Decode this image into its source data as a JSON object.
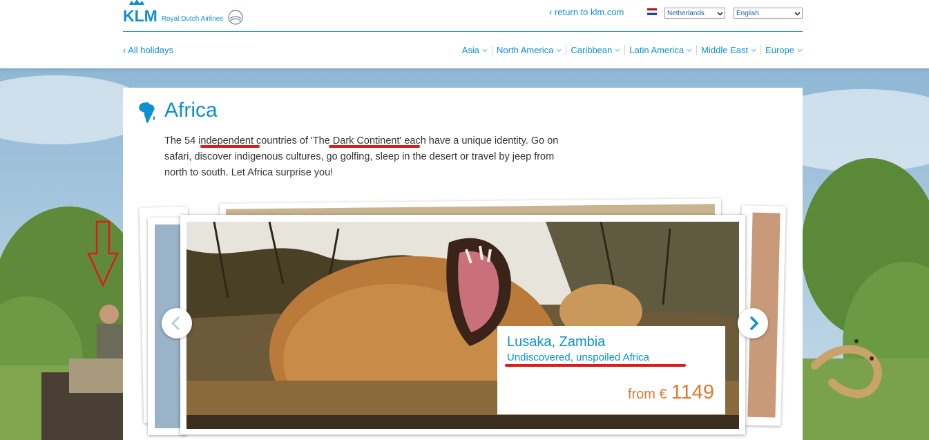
{
  "header": {
    "logo_text": "KLM",
    "logo_subtitle": "Royal Dutch Airlines",
    "return_link": "return to klm.com",
    "country_select": "Netherlands",
    "language_select": "English"
  },
  "nav": {
    "all_holidays": "All holidays",
    "items": [
      "Asia",
      "North America",
      "Caribbean",
      "Latin America",
      "Middle East",
      "Europe"
    ]
  },
  "page": {
    "title": "Africa",
    "intro_parts": [
      "The 54 ",
      "independent",
      " countries of '",
      "The Dark Continent",
      "' each have a unique identity. Go on safari, discover indigenous cultures, go golfing, sleep in the desert or travel by jeep from north to south. Let Africa surprise you!"
    ]
  },
  "carousel": {
    "destination": "Lusaka, Zambia",
    "tagline": "Undiscovered, unspoiled Africa",
    "price_from": "from €",
    "price_value": "1149"
  },
  "colors": {
    "brand_blue": "#0d8fd3",
    "price_orange": "#e07a32",
    "annotation_red": "#dd1b1b"
  }
}
